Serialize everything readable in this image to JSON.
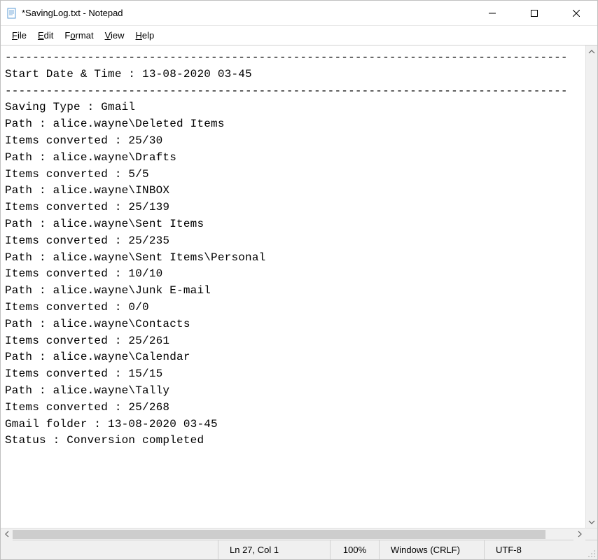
{
  "window": {
    "title": "*SavingLog.txt - Notepad"
  },
  "menu": {
    "file": "File",
    "edit": "Edit",
    "format": "Format",
    "view": "View",
    "help": "Help"
  },
  "content": {
    "lines": [
      "----------------------------------------------------------------------------------",
      "Start Date & Time : 13-08-2020 03-45",
      "----------------------------------------------------------------------------------",
      "Saving Type : Gmail",
      "Path : alice.wayne\\Deleted Items",
      "Items converted : 25/30",
      "Path : alice.wayne\\Drafts",
      "Items converted : 5/5",
      "Path : alice.wayne\\INBOX",
      "Items converted : 25/139",
      "Path : alice.wayne\\Sent Items",
      "Items converted : 25/235",
      "Path : alice.wayne\\Sent Items\\Personal",
      "Items converted : 10/10",
      "Path : alice.wayne\\Junk E-mail",
      "Items converted : 0/0",
      "Path : alice.wayne\\Contacts",
      "Items converted : 25/261",
      "Path : alice.wayne\\Calendar",
      "Items converted : 15/15",
      "Path : alice.wayne\\Tally",
      "Items converted : 25/268",
      "Gmail folder : 13-08-2020 03-45",
      "Status : Conversion completed"
    ]
  },
  "statusbar": {
    "line_col": "Ln 27, Col 1",
    "zoom": "100%",
    "line_ending": "Windows (CRLF)",
    "encoding": "UTF-8"
  }
}
